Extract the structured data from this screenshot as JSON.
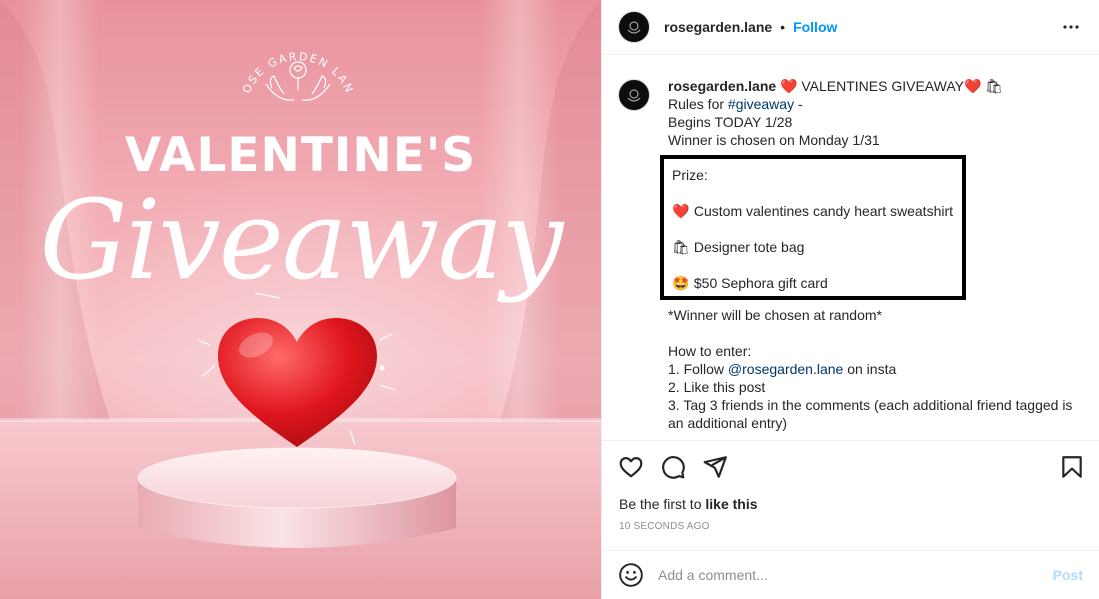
{
  "image": {
    "brand": "ROSE GARDEN LANE",
    "headline": "VALENTINE'S",
    "script": "Giveaway"
  },
  "header": {
    "username": "rosegarden.lane",
    "separator": "•",
    "follow_label": "Follow",
    "more_icon": "more-horizontal-icon"
  },
  "caption": {
    "username": "rosegarden.lane",
    "title": " ❤️ VALENTINES GIVEAWAY❤️ 🛍",
    "rules_prefix": "Rules for ",
    "rules_tag": "#giveaway",
    "rules_suffix": " -",
    "begins": "Begins TODAY 1/28",
    "winner_date": "Winner is chosen on Monday 1/31",
    "prize_heading": "Prize:",
    "prizes": [
      {
        "emoji": "❤️",
        "text": " Custom valentines candy heart sweatshirt"
      },
      {
        "emoji": "🛍",
        "text": " Designer tote bag"
      },
      {
        "emoji": "🤩",
        "text": " $50 Sephora gift card"
      }
    ],
    "random_note": "*Winner will be chosen at random*",
    "how_heading": "How to enter:",
    "step1_prefix": "1. Follow ",
    "step1_mention": "@rosegarden.lane",
    "step1_suffix": " on insta",
    "step2": "2. Like this post",
    "step3": "3. Tag 3 friends in the comments (each additional friend tagged is an additional entry)"
  },
  "likes": {
    "prefix": "Be the first to ",
    "action": "like this"
  },
  "timestamp": "10 SECONDS AGO",
  "comment": {
    "placeholder": "Add a comment...",
    "post_label": "Post"
  },
  "colors": {
    "link_blue": "#0095f6",
    "tag_blue": "#00376b",
    "post_disabled": "#b3dbff",
    "pink": "#f3aeb6"
  }
}
